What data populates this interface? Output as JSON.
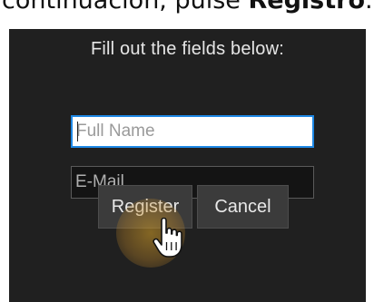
{
  "caption": {
    "prefix": "continuación, pulse ",
    "bold_word": "Registro",
    "suffix": "."
  },
  "dialog": {
    "instruction": "Fill out the fields below:",
    "fields": {
      "full_name_placeholder": "Full Name",
      "email_placeholder": "E-Mail"
    },
    "buttons": {
      "register": "Register",
      "cancel": "Cancel"
    }
  },
  "cursor": {
    "type": "hand-pointer-icon",
    "highlight_color": "#d6a028"
  },
  "colors": {
    "dialog_background": "#202020",
    "focus_border": "#1e88e5",
    "button_background": "#3b3b3b"
  }
}
